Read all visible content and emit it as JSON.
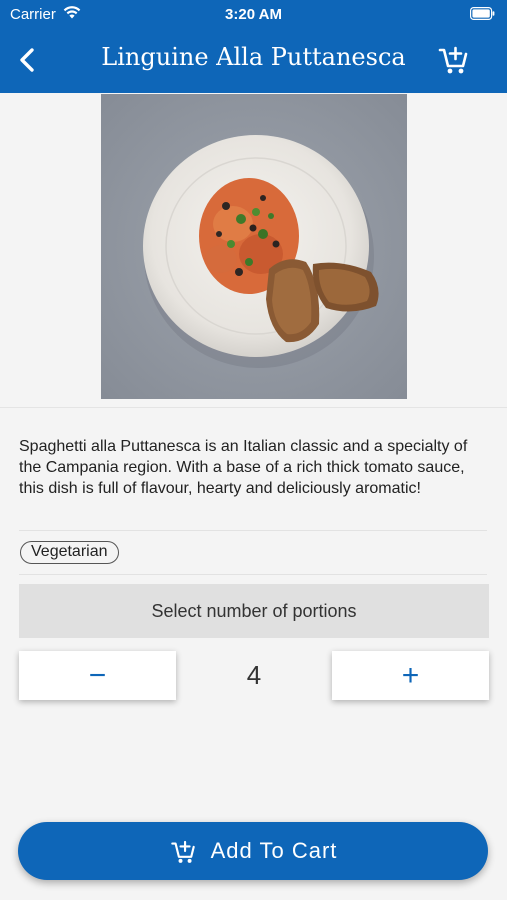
{
  "status_bar": {
    "carrier": "Carrier",
    "time": "3:20 AM",
    "wifi_icon": "wifi-icon",
    "battery_icon": "battery-icon"
  },
  "nav": {
    "title": "Linguine Alla Puttanesca",
    "back_icon": "chevron-left-icon",
    "cart_icon": "cart-plus-icon"
  },
  "hero": {
    "image": "pasta-dish-photo"
  },
  "recipe": {
    "description": "Spaghetti alla Puttanesca is an Italian classic and a specialty of the Campania region. With a base of a rich thick tomato sauce, this dish is full of flavour, hearty and deliciously aromatic!",
    "tags": [
      "Vegetarian"
    ]
  },
  "portions": {
    "header": "Select number of portions",
    "decrement_label": "−",
    "increment_label": "+",
    "count": "4"
  },
  "cart_button": {
    "label": "Add To Cart",
    "icon": "cart-plus-icon"
  },
  "colors": {
    "primary": "#0e66b8",
    "background": "#f4f4f4",
    "portions_header_bg": "#e0e0e0"
  }
}
